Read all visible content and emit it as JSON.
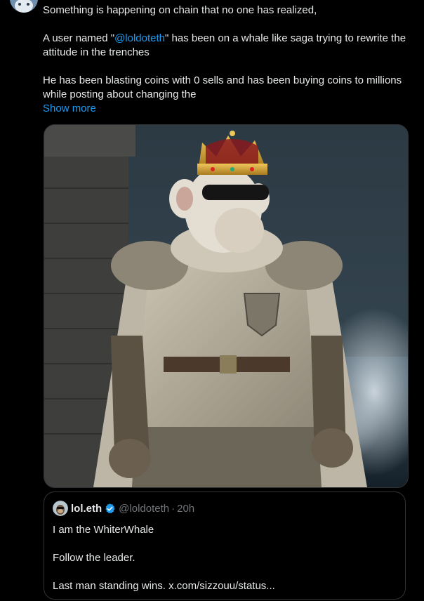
{
  "tweet": {
    "paragraphs": [
      "Something is happening on chain that no one has realized,",
      "He has been blasting coins with 0 sells and has been buying coins to millions while posting about changing the"
    ],
    "para2": {
      "prefix": "A user named \"",
      "mention": "@loldoteth",
      "suffix": "\" has been on a whale like saga trying to rewrite the attitude in the trenches"
    },
    "show_more": "Show more",
    "media_alt_icon": "ape-king-image"
  },
  "quote": {
    "name": "lol.eth",
    "handle": "@loldoteth",
    "separator": "·",
    "time": "20h",
    "lines": [
      "I am the WhiterWhale",
      "Follow the leader.",
      "Last man standing wins. x.com/sizzouu/status..."
    ]
  },
  "colors": {
    "background": "#000000",
    "text": "#e7e9ea",
    "link": "#1d9bf0",
    "muted": "#71767b",
    "border": "#2f3336",
    "verified": "#1d9bf0"
  }
}
